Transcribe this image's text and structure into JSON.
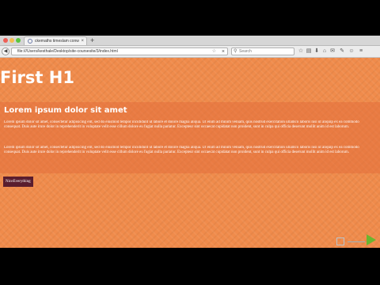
{
  "browser": {
    "tab": {
      "title": "ckemaths timeslam conwet...",
      "close": "×"
    },
    "new_tab": "+",
    "nav": {
      "back": "◀",
      "forward": "▶"
    },
    "url": "file:///Users/kesthale/Desktop/site-coursesite/3/index.html",
    "url_star": "☆",
    "url_stop": "×",
    "search": {
      "icon": "⚲",
      "placeholder": "Search"
    },
    "tools": [
      "☆",
      "▤",
      "⬇",
      "⌂",
      "✉",
      "✎",
      "☺",
      "≡"
    ]
  },
  "page": {
    "h1": "First H1",
    "h2": "Lorem ipsum dolor sit amet",
    "paragraphs": [
      "Lorem ipsum dolor sit amet, consectetur adipisicing elit, sed do eiusmod tempor incididunt ut labore et dolore magna aliqua. Ut enim ad minim veniam, quis nostrud exercitation ullamco laboris nisi ut aliquip ex ea commodo consequat. Duis aute irure dolor in reprehenderit in voluptate velit esse cillum dolore eu fugiat nulla pariatur. Excepteur sint occaecat cupidatat non proident, sunt in culpa qui officia deserunt mollit anim id est laborum.",
      "Lorem ipsum dolor sit amet, consectetur adipisicing elit, sed do eiusmod tempor incididunt ut labore et dolore magna aliqua. Ut enim ad minim veniam, quis nostrud exercitation ullamco laboris nisi ut aliquip ex ea commodo consequat. Duis aute irure dolor in reprehenderit in voluptate velit esse cillum dolore eu fugiat nulla pariatur. Excepteur sint occaecat cupidatat non proident, sunt in culpa qui officia deserunt mollit anim id est laborum."
    ],
    "button": "NiceEverything"
  },
  "colors": {
    "page_bg": "#f08b4b",
    "section_bg": "#e4703c",
    "button_bg": "#5a1d2e",
    "text": "#ffffff"
  }
}
